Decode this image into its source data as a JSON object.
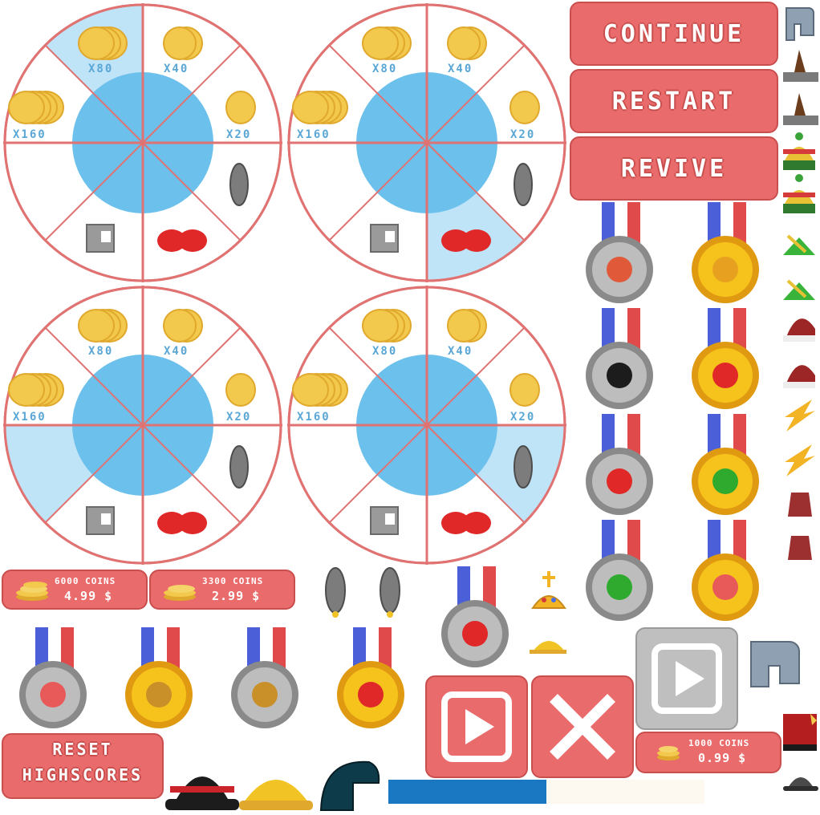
{
  "wheel": {
    "labels": [
      "X80",
      "X40",
      "X160",
      "X20"
    ]
  },
  "buttons": {
    "continue": "Continue",
    "restart": "Restart",
    "revive": "Revive",
    "reset_highscores": [
      "Reset",
      "Highscores"
    ]
  },
  "shop": [
    {
      "coins": "6000 COINS",
      "price": "4.99 $"
    },
    {
      "coins": "3300 COINS",
      "price": "2.99 $"
    },
    {
      "coins": "1000 COINS",
      "price": "0.99 $"
    }
  ],
  "colors": {
    "accent": "#e96b6b",
    "accent_dark": "#c94e4e",
    "wheel_blue": "#6cc0ec",
    "wheel_light": "#bfe3f7",
    "coin": "#f2c94c",
    "progress_blue": "#1a78c2",
    "progress_track": "#fdf8f0"
  },
  "progress": {
    "value": 0.5
  }
}
